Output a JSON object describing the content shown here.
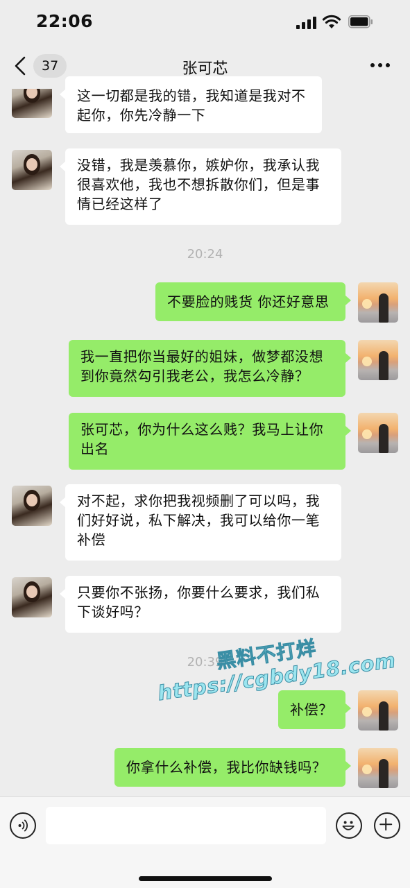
{
  "status_bar": {
    "time": "22:06"
  },
  "nav": {
    "unread_count": "37",
    "title": "张可芯"
  },
  "messages": [
    {
      "side": "in",
      "text": "这一切都是我的错，我知道是我对不起你，你先冷静一下"
    },
    {
      "side": "in",
      "text": "没错，我是羡慕你，嫉妒你，我承认我很喜欢他，我也不想拆散你们，但是事情已经这样了"
    },
    {
      "side": "out",
      "text": "不要脸的贱货 你还好意思"
    },
    {
      "side": "out",
      "text": "我一直把你当最好的姐妹，做梦都没想到你竟然勾引我老公，我怎么冷静？"
    },
    {
      "side": "out",
      "text": "张可芯，你为什么这么贱？我马上让你出名"
    },
    {
      "side": "in",
      "text": "对不起，求你把我视频删了可以吗，我们好好说，私下解决，我可以给你一笔补偿"
    },
    {
      "side": "in",
      "text": "只要你不张扬，你要什么要求，我们私下谈好吗？"
    },
    {
      "side": "out",
      "text": "补偿？"
    },
    {
      "side": "out",
      "text": "你拿什么补偿，我比你缺钱吗？"
    }
  ],
  "timestamps": [
    "20:24",
    "20:39"
  ],
  "watermark": {
    "line1": "黑料不打烊",
    "line2": "https://cgbdy18.com"
  },
  "input_bar": {
    "placeholder": ""
  },
  "icons": {
    "back": "chevron-left-icon",
    "more": "more-icon",
    "voice": "voice-icon",
    "emoji": "emoji-icon",
    "plus": "plus-icon"
  },
  "colors": {
    "outgoing_bubble": "#95ec69",
    "incoming_bubble": "#ffffff",
    "background": "#ededed"
  }
}
